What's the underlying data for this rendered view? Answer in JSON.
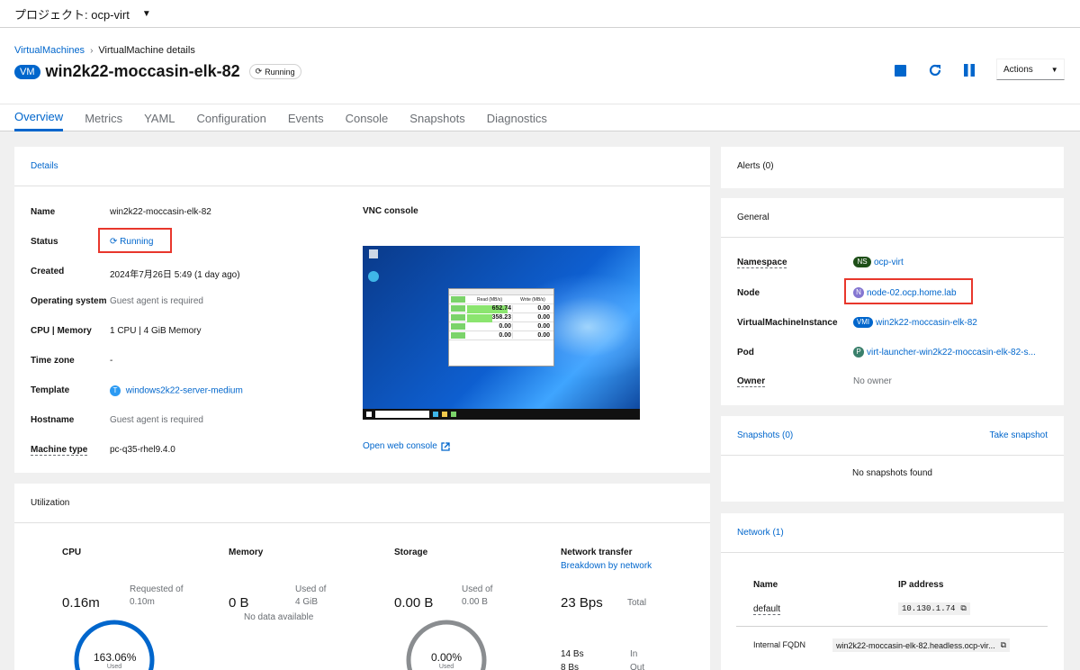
{
  "project": {
    "label": "プロジェクト: ocp-virt"
  },
  "breadcrumb": {
    "parent": "VirtualMachines",
    "current": "VirtualMachine details"
  },
  "vm": {
    "badge": "VM",
    "name": "win2k22-moccasin-elk-82",
    "status": "Running"
  },
  "actions": {
    "label": "Actions"
  },
  "tabs": [
    "Overview",
    "Metrics",
    "YAML",
    "Configuration",
    "Events",
    "Console",
    "Snapshots",
    "Diagnostics"
  ],
  "details": {
    "title": "Details",
    "vnc_title": "VNC console",
    "open_console": "Open web console",
    "rows": [
      {
        "key": "Name",
        "value": "win2k22-moccasin-elk-82"
      },
      {
        "key": "Status",
        "value": "Running"
      },
      {
        "key": "Created",
        "value": "2024年7月26日 5:49 (1 day ago)"
      },
      {
        "key": "Operating system",
        "value": "Guest agent is required"
      },
      {
        "key": "CPU | Memory",
        "value": "1 CPU | 4 GiB Memory"
      },
      {
        "key": "Time zone",
        "value": "-"
      },
      {
        "key": "Template",
        "badge": "T",
        "value": "windows2k22-server-medium"
      },
      {
        "key": "Hostname",
        "value": "Guest agent is required"
      },
      {
        "key": "Machine type",
        "value": "pc-q35-rhel9.4.0"
      }
    ]
  },
  "vnc_app": {
    "col1": "Read (MB/s)",
    "col2": "Write (MB/s)",
    "rows": [
      {
        "read": "652.74",
        "write": "0.00",
        "fill": 0.9
      },
      {
        "read": "358.23",
        "write": "0.00",
        "fill": 0.55
      },
      {
        "read": "0.00",
        "write": "0.00",
        "fill": 0
      },
      {
        "read": "0.00",
        "write": "0.00",
        "fill": 0
      }
    ]
  },
  "alerts": {
    "title": "Alerts (0)"
  },
  "general": {
    "title": "General",
    "namespace": {
      "key": "Namespace",
      "badge": "NS",
      "value": "ocp-virt"
    },
    "node": {
      "key": "Node",
      "badge": "N",
      "value": "node-02.ocp.home.lab"
    },
    "vmi": {
      "key": "VirtualMachineInstance",
      "badge": "VMI",
      "value": "win2k22-moccasin-elk-82"
    },
    "pod": {
      "key": "Pod",
      "badge": "P",
      "value": "virt-launcher-win2k22-moccasin-elk-82-s..."
    },
    "owner": {
      "key": "Owner",
      "value": "No owner"
    }
  },
  "snapshots": {
    "title": "Snapshots (0)",
    "take": "Take snapshot",
    "empty": "No snapshots found"
  },
  "network": {
    "title": "Network (1)",
    "col_name": "Name",
    "col_ip": "IP address",
    "row_name": "default",
    "row_ip": "10.130.1.74",
    "fqdn_key": "Internal FQDN",
    "fqdn_value": "win2k22-moccasin-elk-82.headless.ocp-vir..."
  },
  "utilization": {
    "title": "Utilization",
    "cpu": {
      "head": "CPU",
      "value": "0.16m",
      "req_label": "Requested of",
      "req_value": "0.10m",
      "donut": "163.06%",
      "donut_sub": "Used"
    },
    "memory": {
      "head": "Memory",
      "value": "0 B",
      "used_label": "Used of",
      "used_value": "4 GiB",
      "note": "No data available"
    },
    "storage": {
      "head": "Storage",
      "value": "0.00 B",
      "used_label": "Used of",
      "used_value": "0.00 B",
      "donut": "0.00%",
      "donut_sub": "Used"
    },
    "network": {
      "head": "Network transfer",
      "link": "Breakdown by network",
      "value": "23 Bps",
      "total": "Total",
      "in_value": "14 Bs",
      "in_label": "In",
      "out_value": "8 Bs",
      "out_label": "Out"
    }
  },
  "colors": {
    "accent": "#0066cc",
    "highlight": "#e8372c",
    "ns_badge": "#1e4f18",
    "node_badge": "#8476d1",
    "pod_badge": "#3a7f6b"
  }
}
